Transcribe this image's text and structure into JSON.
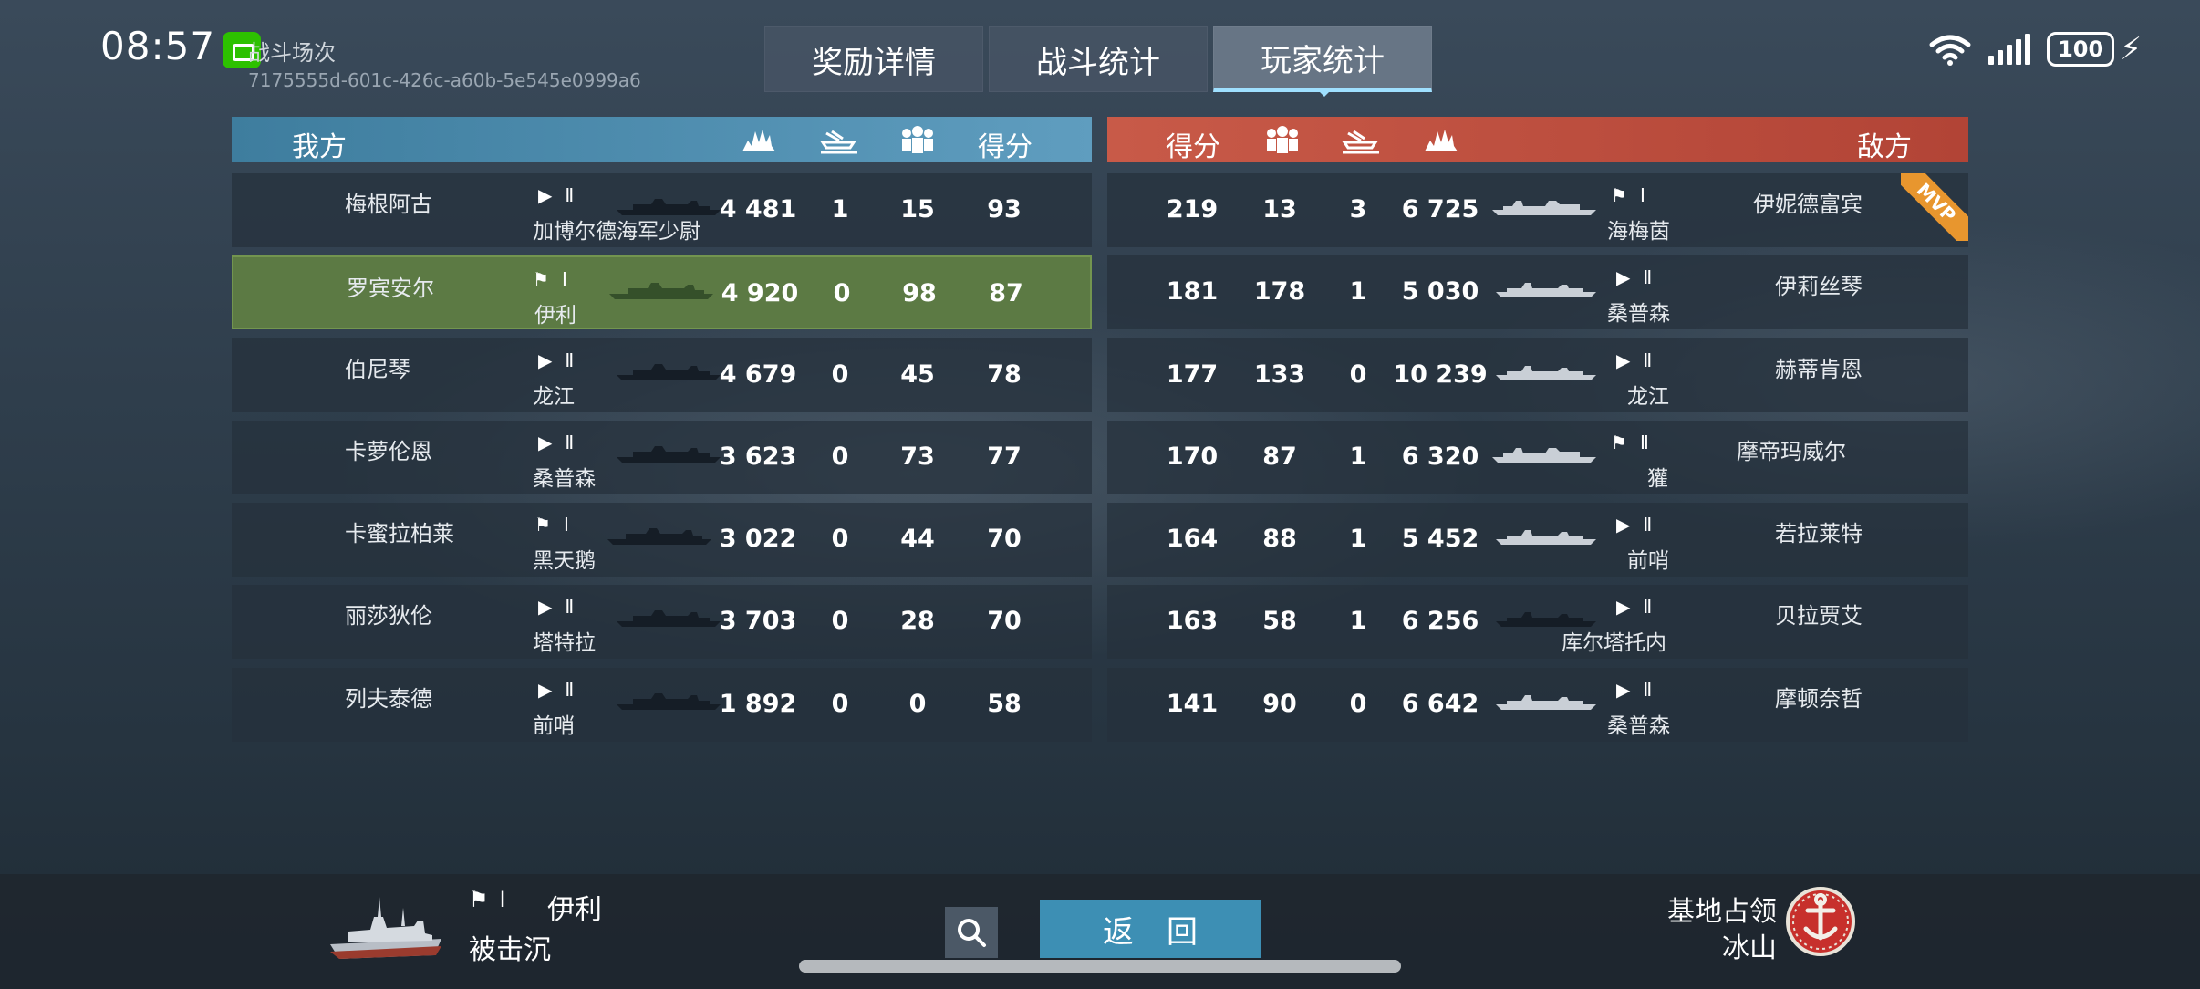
{
  "status_bar": {
    "time": "08:57",
    "battery": "100"
  },
  "battle": {
    "label": "战斗场次",
    "id": "7175555d-601c-426c-a60b-5e545e0999a6"
  },
  "tabs": [
    {
      "label": "奖励详情",
      "active": false
    },
    {
      "label": "战斗统计",
      "active": false
    },
    {
      "label": "玩家统计",
      "active": true
    }
  ],
  "headers": {
    "ally": {
      "team": "我方",
      "score": "得分"
    },
    "enemy": {
      "team": "敌方",
      "score": "得分"
    },
    "icons": [
      "damage-icon",
      "kills-icon",
      "assist-icon"
    ]
  },
  "ally_rows": [
    {
      "name": "梅根阿古",
      "ship": "加博尔德海军少尉",
      "tier": "Ⅱ",
      "rank_flag": false,
      "damage": "4 481",
      "kills": "1",
      "assist": "15",
      "score": "93"
    },
    {
      "name": "罗宾安尔",
      "ship": "伊利",
      "tier": "Ⅰ",
      "rank_flag": true,
      "damage": "4 920",
      "kills": "0",
      "assist": "98",
      "score": "87",
      "is_me": true
    },
    {
      "name": "伯尼琴",
      "ship": "龙江",
      "tier": "Ⅱ",
      "rank_flag": false,
      "damage": "4 679",
      "kills": "0",
      "assist": "45",
      "score": "78"
    },
    {
      "name": "卡萝伦恩",
      "ship": "桑普森",
      "tier": "Ⅱ",
      "rank_flag": false,
      "damage": "3 623",
      "kills": "0",
      "assist": "73",
      "score": "77"
    },
    {
      "name": "卡蜜拉柏莱",
      "ship": "黑天鹅",
      "tier": "Ⅰ",
      "rank_flag": true,
      "damage": "3 022",
      "kills": "0",
      "assist": "44",
      "score": "70"
    },
    {
      "name": "丽莎狄伦",
      "ship": "塔特拉",
      "tier": "Ⅱ",
      "rank_flag": false,
      "damage": "3 703",
      "kills": "0",
      "assist": "28",
      "score": "70"
    },
    {
      "name": "列夫泰德",
      "ship": "前哨",
      "tier": "Ⅱ",
      "rank_flag": false,
      "damage": "1 892",
      "kills": "0",
      "assist": "0",
      "score": "58"
    }
  ],
  "enemy_rows": [
    {
      "name": "伊妮德富宾",
      "ship": "海梅茵",
      "tier": "Ⅰ",
      "rank_flag": true,
      "damage": "6 725",
      "kills": "3",
      "assist": "13",
      "score": "219",
      "mvp": "MVP"
    },
    {
      "name": "伊莉丝琴",
      "ship": "桑普森",
      "tier": "Ⅱ",
      "rank_flag": false,
      "damage": "5 030",
      "kills": "1",
      "assist": "178",
      "score": "181"
    },
    {
      "name": "赫蒂肯恩",
      "ship": "龙江",
      "tier": "Ⅱ",
      "rank_flag": false,
      "damage": "10 239",
      "kills": "0",
      "assist": "133",
      "score": "177"
    },
    {
      "name": "摩帝玛威尔",
      "ship": "獾",
      "tier": "Ⅱ",
      "rank_flag": true,
      "damage": "6 320",
      "kills": "1",
      "assist": "87",
      "score": "170"
    },
    {
      "name": "若拉莱特",
      "ship": "前哨",
      "tier": "Ⅱ",
      "rank_flag": false,
      "damage": "5 452",
      "kills": "1",
      "assist": "88",
      "score": "164"
    },
    {
      "name": "贝拉贾艾",
      "ship": "库尔塔托内",
      "tier": "Ⅱ",
      "rank_flag": false,
      "damage": "6 256",
      "kills": "1",
      "assist": "58",
      "score": "163"
    },
    {
      "name": "摩顿奈哲",
      "ship": "桑普森",
      "tier": "Ⅱ",
      "rank_flag": false,
      "damage": "6 642",
      "kills": "0",
      "assist": "90",
      "score": "141"
    }
  ],
  "player": {
    "tier": "Ⅰ",
    "ship": "伊利",
    "status": "被击沉"
  },
  "footer": {
    "return_label": "返回",
    "mode": "基地占领",
    "map": "冰山"
  },
  "colors": {
    "ally": "#4f8eb0",
    "enemy": "#c0503f",
    "me_row": "#5c7a44",
    "mvp": "#e8962e",
    "accent": "#9fe0ff"
  }
}
